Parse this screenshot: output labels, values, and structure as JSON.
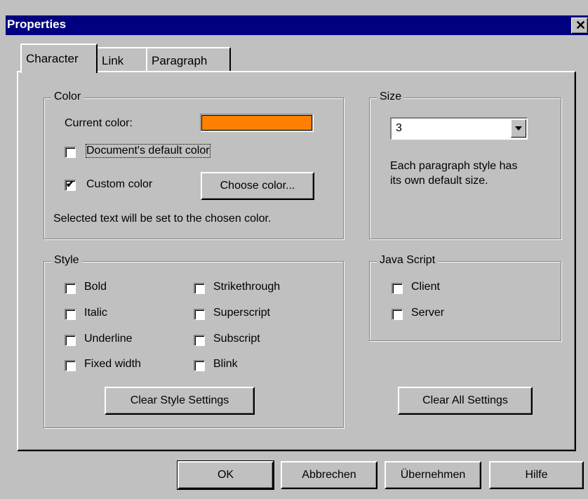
{
  "window": {
    "title": "Properties",
    "close_glyph": "✕"
  },
  "tabs": [
    {
      "label": "Character",
      "active": true
    },
    {
      "label": "Link",
      "active": false
    },
    {
      "label": "Paragraph",
      "active": false
    }
  ],
  "color_group": {
    "legend": "Color",
    "current_color_label": "Current color:",
    "current_color_value": "#ff8000",
    "document_default": {
      "label": "Document's default color",
      "checked": false
    },
    "custom_color": {
      "label": "Custom color",
      "checked": true
    },
    "choose_button": "Choose color...",
    "note": "Selected text will be set to the chosen color."
  },
  "size_group": {
    "legend": "Size",
    "selected": "3",
    "note_line1": "Each paragraph style has",
    "note_line2": "its own default size."
  },
  "style_group": {
    "legend": "Style",
    "left": [
      {
        "label": "Bold",
        "checked": false
      },
      {
        "label": "Italic",
        "checked": false
      },
      {
        "label": "Underline",
        "checked": false
      },
      {
        "label": "Fixed width",
        "checked": false
      }
    ],
    "right": [
      {
        "label": "Strikethrough",
        "checked": false
      },
      {
        "label": "Superscript",
        "checked": false
      },
      {
        "label": "Subscript",
        "checked": false
      },
      {
        "label": "Blink",
        "checked": false
      }
    ],
    "clear_button": "Clear Style Settings"
  },
  "javascript_group": {
    "legend": "Java Script",
    "client": {
      "label": "Client",
      "checked": false
    },
    "server": {
      "label": "Server",
      "checked": false
    }
  },
  "clear_all_button": "Clear All Settings",
  "footer": {
    "ok": "OK",
    "cancel": "Abbrechen",
    "apply": "Übernehmen",
    "help": "Hilfe"
  }
}
